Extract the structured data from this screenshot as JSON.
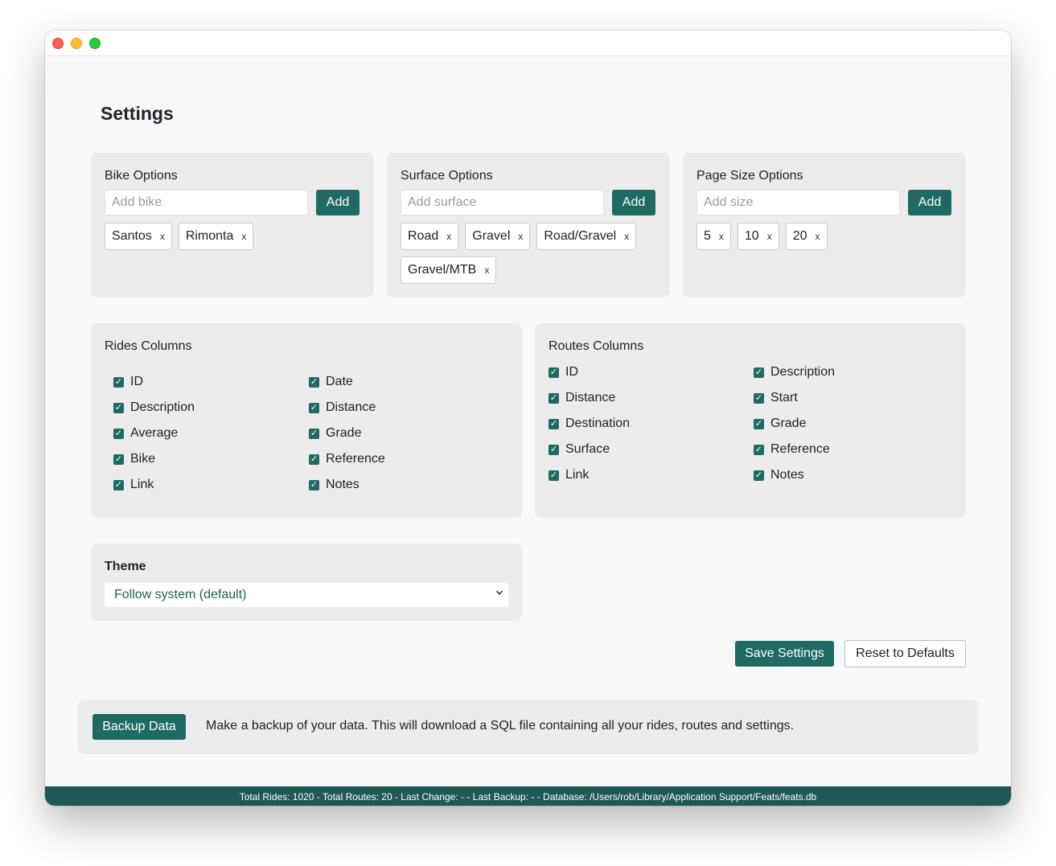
{
  "page": {
    "title": "Settings"
  },
  "bike_options": {
    "title": "Bike Options",
    "placeholder": "Add bike",
    "add_label": "Add",
    "items": [
      "Santos",
      "Rimonta"
    ]
  },
  "surface_options": {
    "title": "Surface Options",
    "placeholder": "Add surface",
    "add_label": "Add",
    "items": [
      "Road",
      "Gravel",
      "Road/Gravel",
      "Gravel/MTB"
    ]
  },
  "page_size_options": {
    "title": "Page Size Options",
    "placeholder": "Add size",
    "add_label": "Add",
    "items": [
      "5",
      "10",
      "20"
    ]
  },
  "chip_remove_glyph": "x",
  "rides_columns": {
    "title": "Rides Columns",
    "items": [
      {
        "label": "ID",
        "checked": true
      },
      {
        "label": "Date",
        "checked": true
      },
      {
        "label": "Description",
        "checked": true
      },
      {
        "label": "Distance",
        "checked": true
      },
      {
        "label": "Average",
        "checked": true
      },
      {
        "label": "Grade",
        "checked": true
      },
      {
        "label": "Bike",
        "checked": true
      },
      {
        "label": "Reference",
        "checked": true
      },
      {
        "label": "Link",
        "checked": true
      },
      {
        "label": "Notes",
        "checked": true
      }
    ]
  },
  "routes_columns": {
    "title": "Routes Columns",
    "items": [
      {
        "label": "ID",
        "checked": true
      },
      {
        "label": "Description",
        "checked": true
      },
      {
        "label": "Distance",
        "checked": true
      },
      {
        "label": "Start",
        "checked": true
      },
      {
        "label": "Destination",
        "checked": true
      },
      {
        "label": "Grade",
        "checked": true
      },
      {
        "label": "Surface",
        "checked": true
      },
      {
        "label": "Reference",
        "checked": true
      },
      {
        "label": "Link",
        "checked": true
      },
      {
        "label": "Notes",
        "checked": true
      }
    ]
  },
  "theme": {
    "title": "Theme",
    "selected": "Follow system (default)"
  },
  "actions": {
    "save_label": "Save Settings",
    "reset_label": "Reset to Defaults"
  },
  "backup": {
    "button_label": "Backup Data",
    "description": "Make a backup of your data. This will download a SQL file containing all your rides, routes and settings."
  },
  "status_bar": {
    "text": "Total Rides: 1020 - Total Routes: 20 - Last Change: - - Last Backup: - - Database: /Users/rob/Library/Application Support/Feats/feats.db"
  },
  "colors": {
    "accent": "#1f6b63",
    "status_bar": "#1f5955",
    "card": "#ececec",
    "window": "#f7f8fa"
  },
  "icons": {
    "checkbox": "checkbox-checked-icon",
    "select_chevron": "chevron-down-icon",
    "chip_remove": "close-icon"
  }
}
